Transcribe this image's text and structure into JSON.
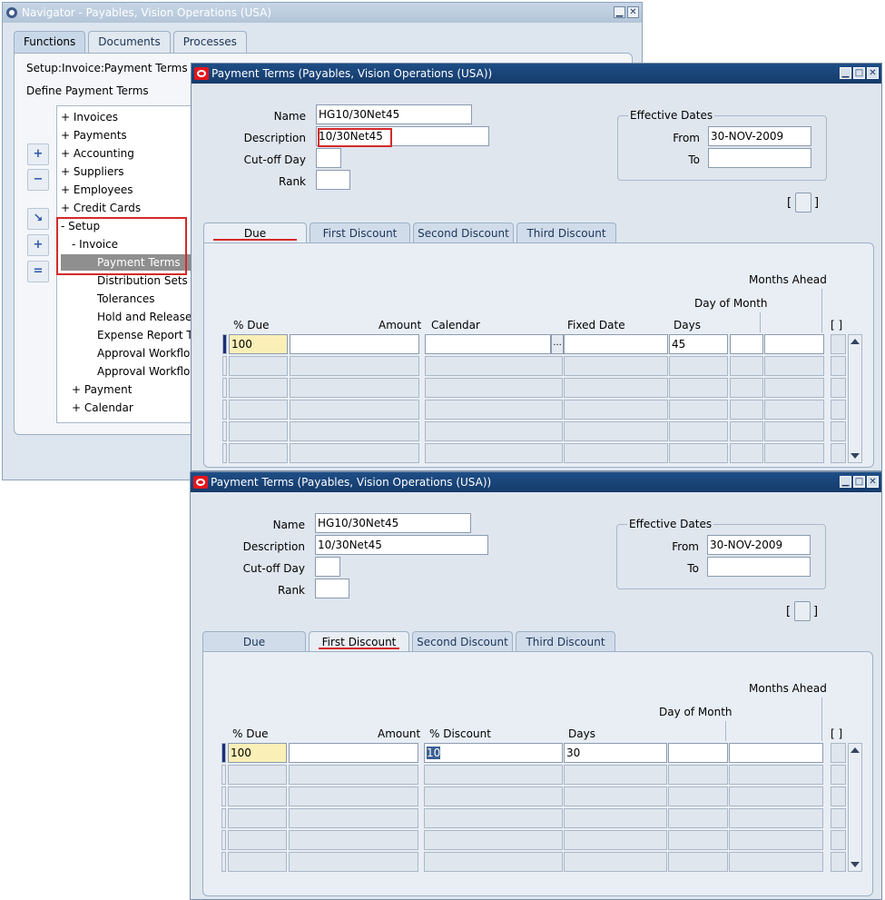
{
  "navigator": {
    "title": "Navigator - Payables, Vision Operations (USA)",
    "tabs": [
      "Functions",
      "Documents",
      "Processes"
    ],
    "path": "Setup:Invoice:Payment Terms",
    "define": "Define Payment Terms",
    "tree": [
      "+  Invoices",
      "+  Payments",
      "+  Accounting",
      "+  Suppliers",
      "+  Employees",
      "+  Credit Cards",
      "-  Setup",
      "-  Invoice",
      "Payment Terms",
      "Distribution Sets",
      "Tolerances",
      "Hold and Release",
      "Expense Report T",
      "Approval Workflow",
      "Approval Workflow",
      "+  Payment",
      "+  Calendar"
    ],
    "side_buttons": [
      "+",
      "−",
      "↘",
      "+",
      "="
    ]
  },
  "window_title": "Payment Terms (Payables, Vision Operations (USA))",
  "form": {
    "name_label": "Name",
    "description_label": "Description",
    "cutoff_label": "Cut-off Day",
    "rank_label": "Rank",
    "name": "HG10/30Net45",
    "description": "10/30Net45",
    "cutoff": "",
    "rank": "",
    "effective_dates_label": "Effective Dates",
    "from_label": "From",
    "to_label": "To",
    "from": "30-NOV-2009",
    "to": ""
  },
  "tabs": [
    "Due",
    "First Discount",
    "Second Discount",
    "Third Discount"
  ],
  "due_grid": {
    "months_ahead": "Months Ahead",
    "day_of_month": "Day of Month",
    "headers": [
      "% Due",
      "Amount",
      "Calendar",
      "Fixed Date",
      "Days"
    ],
    "row1": {
      "pct_due": "100",
      "amount": "",
      "calendar": "",
      "fixed_date": "",
      "days": "45"
    },
    "bracket": "[ ]",
    "lov": "..."
  },
  "discount_grid": {
    "months_ahead": "Months Ahead",
    "day_of_month": "Day of Month",
    "headers": [
      "% Due",
      "Amount",
      "% Discount",
      "Days"
    ],
    "row1": {
      "pct_due": "100",
      "amount": "",
      "discount": "10",
      "days": "30"
    },
    "bracket": "[ ]"
  },
  "folder_bracket_left": "[",
  "folder_bracket_right": "]"
}
